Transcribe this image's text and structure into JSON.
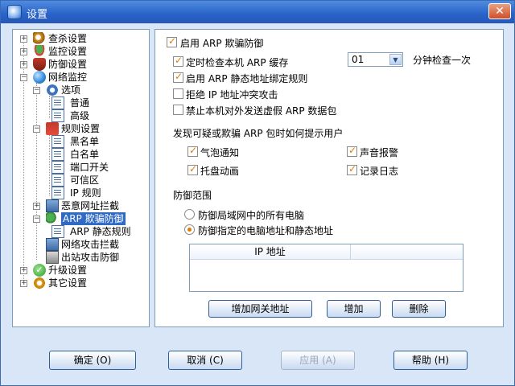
{
  "window": {
    "title": "设置",
    "close": "✕"
  },
  "tree": {
    "items": [
      {
        "label": "查杀设置"
      },
      {
        "label": "监控设置"
      },
      {
        "label": "防御设置"
      },
      {
        "label": "网络监控"
      },
      {
        "label": "选项"
      },
      {
        "label": "普通"
      },
      {
        "label": "高级"
      },
      {
        "label": "规则设置"
      },
      {
        "label": "黑名单"
      },
      {
        "label": "白名单"
      },
      {
        "label": "端口开关"
      },
      {
        "label": "可信区"
      },
      {
        "label": "IP 规则"
      },
      {
        "label": "恶意网址拦截"
      },
      {
        "label": "ARP 欺骗防御"
      },
      {
        "label": "ARP 静态规则"
      },
      {
        "label": "网络攻击拦截"
      },
      {
        "label": "出站攻击防御"
      },
      {
        "label": "升级设置"
      },
      {
        "label": "其它设置"
      }
    ]
  },
  "arp": {
    "enable_label": "启用 ARP 欺骗防御",
    "timed_check_label": "定时检查本机 ARP 缓存",
    "interval_value": "01",
    "interval_suffix": "分钟检查一次",
    "static_bind_label": "启用 ARP 静态地址绑定规则",
    "reject_conflict_label": "拒绝 IP 地址冲突攻击",
    "block_fake_label": "禁止本机对外发送虚假 ARP 数据包",
    "notify_heading": "发现可疑或欺骗 ARP 包时如何提示用户",
    "notify_bubble": "气泡通知",
    "notify_sound": "声音报警",
    "notify_tray": "托盘动画",
    "notify_log": "记录日志",
    "scope_heading": "防御范围",
    "scope_all": "防御局域网中的所有电脑",
    "scope_specified": "防御指定的电脑地址和静态地址",
    "grid_header_ip": "IP 地址",
    "btn_add_gateway": "增加网关地址",
    "btn_add": "增加",
    "btn_delete": "删除"
  },
  "footer": {
    "ok": "确定 (O)",
    "cancel": "取消 (C)",
    "apply": "应用 (A)",
    "help": "帮助 (H)"
  },
  "colors": {
    "accent": "#e07b00",
    "selection": "#316ac5",
    "window_bg": "#d9e6f7"
  }
}
